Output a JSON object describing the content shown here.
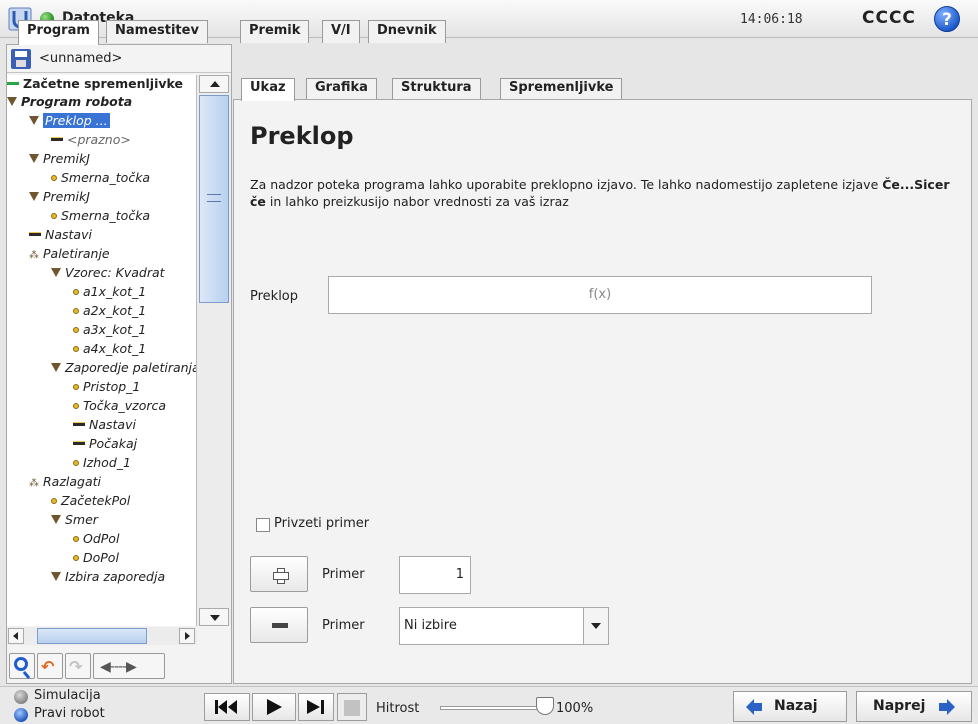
{
  "app": {
    "title": "Datoteka",
    "clock": "14:06:18",
    "robot_name": "CCCC",
    "help_label": "?"
  },
  "main_tabs": [
    {
      "label": "Program",
      "active": true
    },
    {
      "label": "Namestitev"
    },
    {
      "label": "Premik"
    },
    {
      "label": "V/I"
    },
    {
      "label": "Dnevnik"
    }
  ],
  "file": {
    "name": "<unnamed>"
  },
  "tree": [
    {
      "label": "Začetne spremenljivke",
      "icon": "green-bar-icon"
    },
    {
      "label": "Program robota",
      "icon": "triangle-icon"
    },
    {
      "label": "Preklop ...",
      "icon": "triangle-icon",
      "selected": true
    },
    {
      "label": "<prazno>",
      "icon": "bar-icon"
    },
    {
      "label": "PremikJ",
      "icon": "triangle-icon"
    },
    {
      "label": "Smerna_točka",
      "icon": "dot-icon"
    },
    {
      "label": "PremikJ",
      "icon": "triangle-icon"
    },
    {
      "label": "Smerna_točka",
      "icon": "dot-icon"
    },
    {
      "label": "Nastavi",
      "icon": "bar-icon"
    },
    {
      "label": "Paletiranje",
      "icon": "pallet-icon"
    },
    {
      "label": "Vzorec: Kvadrat",
      "icon": "triangle-icon"
    },
    {
      "label": "a1x_kot_1",
      "icon": "dot-icon"
    },
    {
      "label": "a2x_kot_1",
      "icon": "dot-icon"
    },
    {
      "label": "a3x_kot_1",
      "icon": "dot-icon"
    },
    {
      "label": "a4x_kot_1",
      "icon": "dot-icon"
    },
    {
      "label": "Zaporedje paletiranja",
      "icon": "triangle-icon"
    },
    {
      "label": "Pristop_1",
      "icon": "dot-icon"
    },
    {
      "label": "Točka_vzorca",
      "icon": "dot-icon"
    },
    {
      "label": "Nastavi",
      "icon": "bar-icon"
    },
    {
      "label": "Počakaj",
      "icon": "bar-icon"
    },
    {
      "label": "Izhod_1",
      "icon": "dot-icon"
    },
    {
      "label": "Razlagati",
      "icon": "pallet-icon"
    },
    {
      "label": "ZačetekPol",
      "icon": "dot-icon"
    },
    {
      "label": "Smer",
      "icon": "triangle-icon"
    },
    {
      "label": "OdPol",
      "icon": "dot-icon"
    },
    {
      "label": "DoPol",
      "icon": "dot-icon"
    },
    {
      "label": "Izbira zaporedja",
      "icon": "triangle-icon"
    }
  ],
  "tree_scroll_position": 0.0,
  "tree_tools": {
    "search_icon": "search-icon",
    "undo_icon": "undo-icon",
    "redo_icon": "redo-icon",
    "move_icon": "move-icon"
  },
  "sub_tabs": [
    {
      "label": "Ukaz",
      "active": true
    },
    {
      "label": "Grafika"
    },
    {
      "label": "Struktura"
    },
    {
      "label": "Spremenljivke"
    }
  ],
  "command": {
    "title": "Preklop",
    "description_1": "Za nadzor poteka programa lahko uporabite preklopno izjavo. Te lahko nadomestijo zapletene izjave ",
    "description_bold_1": "Če...Sicer če",
    "description_2": " in lahko preizkusijo nabor vrednosti za vaš izraz",
    "switch_label": "Preklop",
    "expression_placeholder": "f(x)",
    "default_case_label": "Privzeti primer",
    "default_case_checked": false,
    "add_case_label": "Primer",
    "add_case_value": "1",
    "remove_case_label": "Primer",
    "remove_case_selected": "Ni izbire"
  },
  "footer": {
    "simulation_label": "Simulacija",
    "real_robot_label": "Pravi robot",
    "selected_mode": "Pravi robot",
    "speed_label": "Hitrost",
    "speed_value": "100%",
    "speed_fraction": 1.0,
    "back_label": "Nazaj",
    "next_label": "Naprej"
  },
  "colors": {
    "accent": "#3a73d6",
    "status_ok": "#1f8a1a",
    "nav_arrow": "#2b62c6"
  }
}
